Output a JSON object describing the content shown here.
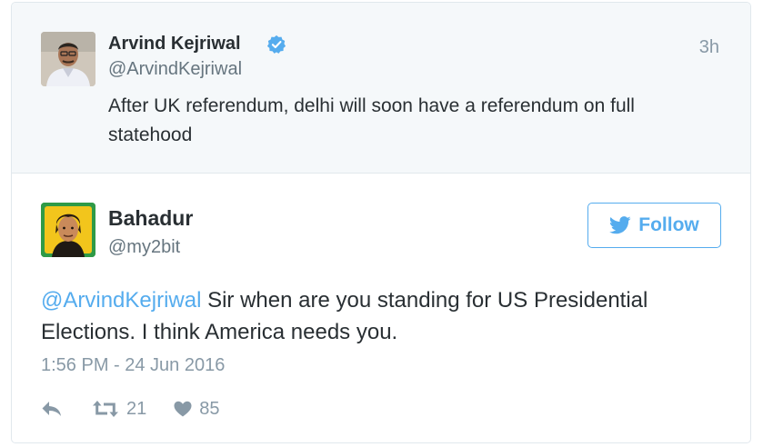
{
  "parent_tweet": {
    "name": "Arvind Kejriwal",
    "handle": "@ArvindKejriwal",
    "time": "3h",
    "text": "After UK referendum, delhi will soon have a referendum on full statehood",
    "verified": true
  },
  "reply_tweet": {
    "name": "Bahadur",
    "handle": "@my2bit",
    "follow_label": "Follow",
    "mention": "@ArvindKejriwal",
    "text": " Sir when are you standing for US Presidential Elections. I think America needs you.",
    "date": "1:56 PM - 24 Jun 2016",
    "retweets": "21",
    "likes": "85"
  },
  "colors": {
    "accent": "#55acee",
    "muted": "#8899a6",
    "parent_bg": "#f5f8fa",
    "text": "#292f33"
  },
  "icons": {
    "verified": "verified-badge-icon",
    "bird": "twitter-bird-icon",
    "reply": "reply-icon",
    "retweet": "retweet-icon",
    "like": "heart-icon"
  }
}
